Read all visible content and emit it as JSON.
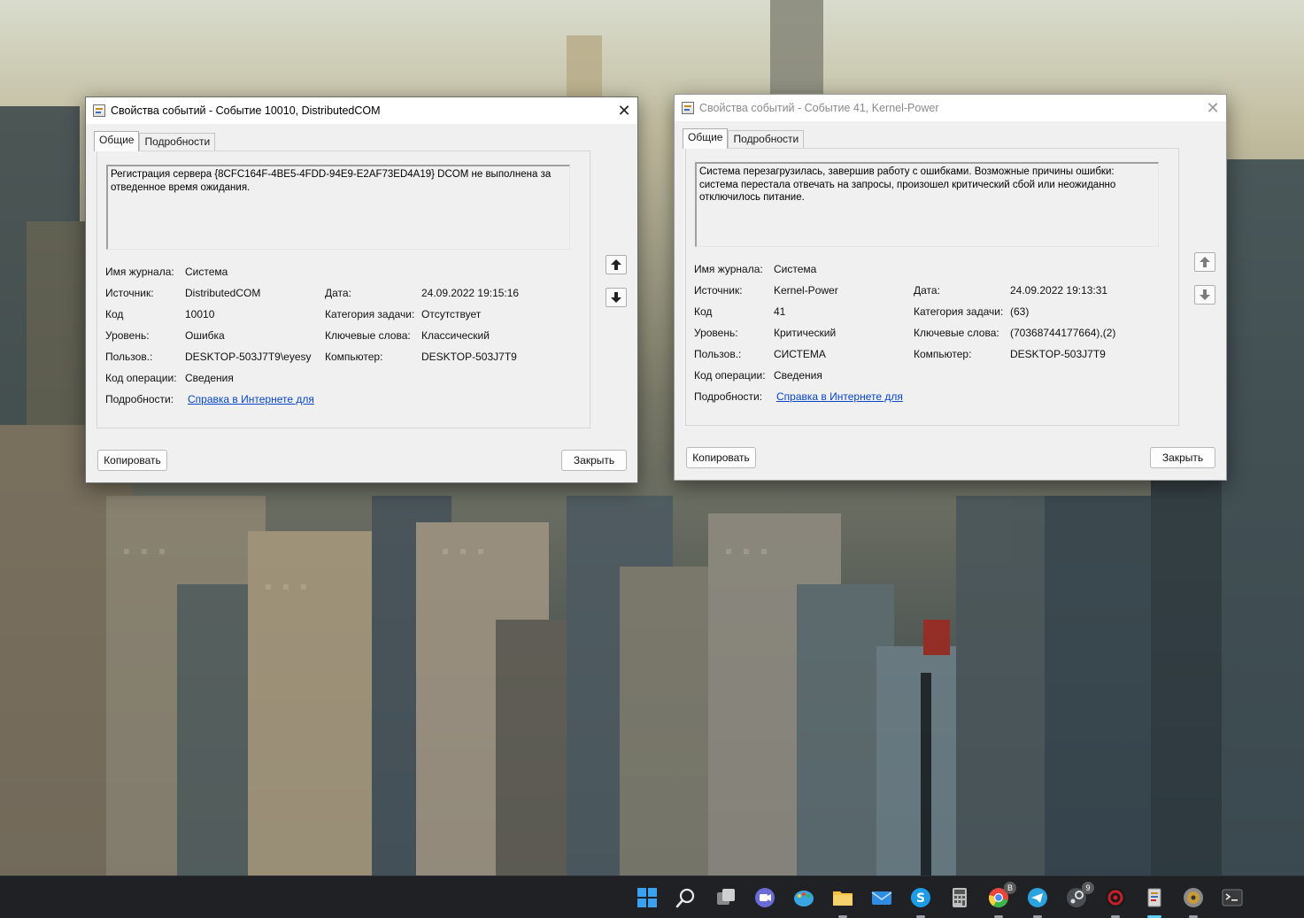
{
  "left_dialog": {
    "title": "Свойства событий - Событие 10010, DistributedCOM",
    "tabs": [
      "Общие",
      "Подробности"
    ],
    "message": "Регистрация сервера {8CFC164F-4BE5-4FDD-94E9-E2AF73ED4A19} DCOM не выполнена за отведенное время ожидания.",
    "fields": {
      "log_name_label": "Имя журнала:",
      "log_name": "Система",
      "source_label": "Источник:",
      "source": "DistributedCOM",
      "date_label": "Дата:",
      "date": "24.09.2022 19:15:16",
      "code_label": "Код",
      "code": "10010",
      "task_label": "Категория задачи:",
      "task": "Отсутствует",
      "level_label": "Уровень:",
      "level": "Ошибка",
      "keywords_label": "Ключевые слова:",
      "keywords": "Классический",
      "user_label": "Пользов.:",
      "user": "DESKTOP-503J7T9\\eyesy",
      "computer_label": "Компьютер:",
      "computer": "DESKTOP-503J7T9",
      "opcode_label": "Код операции:",
      "opcode": "Сведения",
      "details_label": "Подробности:",
      "details_link": "Справка в Интернете для "
    },
    "copy_button": "Копировать",
    "close_button": "Закрыть"
  },
  "right_dialog": {
    "title": "Свойства событий - Событие 41, Kernel-Power",
    "tabs": [
      "Общие",
      "Подробности"
    ],
    "message": "Система перезагрузилась, завершив работу с ошибками. Возможные причины ошибки: система перестала отвечать на запросы, произошел критический сбой или неожиданно отключилось питание.",
    "fields": {
      "log_name_label": "Имя журнала:",
      "log_name": "Система",
      "source_label": "Источник:",
      "source": "Kernel-Power",
      "date_label": "Дата:",
      "date": "24.09.2022 19:13:31",
      "code_label": "Код",
      "code": "41",
      "task_label": "Категория задачи:",
      "task": "(63)",
      "level_label": "Уровень:",
      "level": "Критический",
      "keywords_label": "Ключевые слова:",
      "keywords": "(70368744177664),(2)",
      "user_label": "Пользов.:",
      "user": "СИСТЕМА",
      "computer_label": "Компьютер:",
      "computer": "DESKTOP-503J7T9",
      "opcode_label": "Код операции:",
      "opcode": "Сведения",
      "details_label": "Подробности:",
      "details_link": "Справка в Интернете для "
    },
    "copy_button": "Копировать",
    "close_button": "Закрыть"
  },
  "taskbar": {
    "icons": [
      {
        "name": "start-icon",
        "color": "#3aa0f0"
      },
      {
        "name": "search-icon",
        "color": "#e8e8e8"
      },
      {
        "name": "task-view-icon",
        "color": "#d0d0d0"
      },
      {
        "name": "teams-chat-icon",
        "color": "#6b6bd6"
      },
      {
        "name": "paint-icon",
        "color": "#39a6e0"
      },
      {
        "name": "file-explorer-icon",
        "color": "#f3c240"
      },
      {
        "name": "mail-icon",
        "color": "#2f8ce0"
      },
      {
        "name": "skype-icon",
        "color": "#1e9be6"
      },
      {
        "name": "calculator-icon",
        "color": "#bfbfbf"
      },
      {
        "name": "chrome-icon",
        "color": "#4c8bf5",
        "badge": "B"
      },
      {
        "name": "telegram-icon",
        "color": "#2aa3df"
      },
      {
        "name": "steam-icon",
        "color": "#4a4f55",
        "badge": "9"
      },
      {
        "name": "antivirus-icon",
        "color": "#c8202a"
      },
      {
        "name": "event-viewer-icon",
        "color": "#d9d9d9"
      },
      {
        "name": "disk-utility-icon",
        "color": "#c89a3a"
      },
      {
        "name": "terminal-icon",
        "color": "#3a3a3a"
      }
    ]
  }
}
